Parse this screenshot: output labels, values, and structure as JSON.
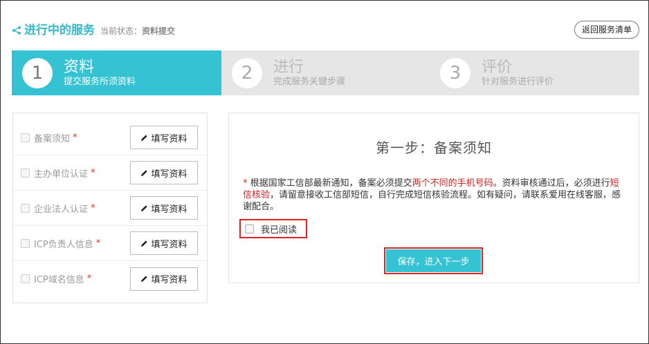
{
  "header": {
    "title": "进行中的服务",
    "status_label": "当前状态：",
    "status_value": "资料提交",
    "back_button": "返回服务清单"
  },
  "steps": [
    {
      "number": "1",
      "title": "资料",
      "desc": "提交服务所须资料",
      "active": true
    },
    {
      "number": "2",
      "title": "进行",
      "desc": "完成服务关键步骤",
      "active": false
    },
    {
      "number": "3",
      "title": "评价",
      "desc": "针对服务进行评价",
      "active": false
    }
  ],
  "tasks": [
    {
      "label": "备案须知",
      "required": "*",
      "button": "填写资料"
    },
    {
      "label": "主办单位认证",
      "required": "*",
      "button": "填写资料"
    },
    {
      "label": "企业法人认证",
      "required": "*",
      "button": "填写资料"
    },
    {
      "label": "ICP负责人信息",
      "required": "*",
      "button": "填写资料"
    },
    {
      "label": "ICP域名信息",
      "required": "*",
      "button": "填写资料"
    }
  ],
  "panel": {
    "title": "第一步：备案须知",
    "notice_star": "*",
    "notice_part1": " 根据国家工信部最新通知，备案必须提交",
    "notice_hl1": "两个不同的手机号码",
    "notice_part2": "。资料审核通过后，必须进行",
    "notice_hl2": "短信核验",
    "notice_part3": "，请留意接收工信部短信，自行完成短信核验流程。如有疑问，请联系爱用在线客服，感谢配合。",
    "read_label": "我已阅读",
    "save_button": "保存，进入下一步"
  },
  "colors": {
    "accent": "#35c3d4",
    "highlight": "#c9211e",
    "required": "#e0312b"
  }
}
